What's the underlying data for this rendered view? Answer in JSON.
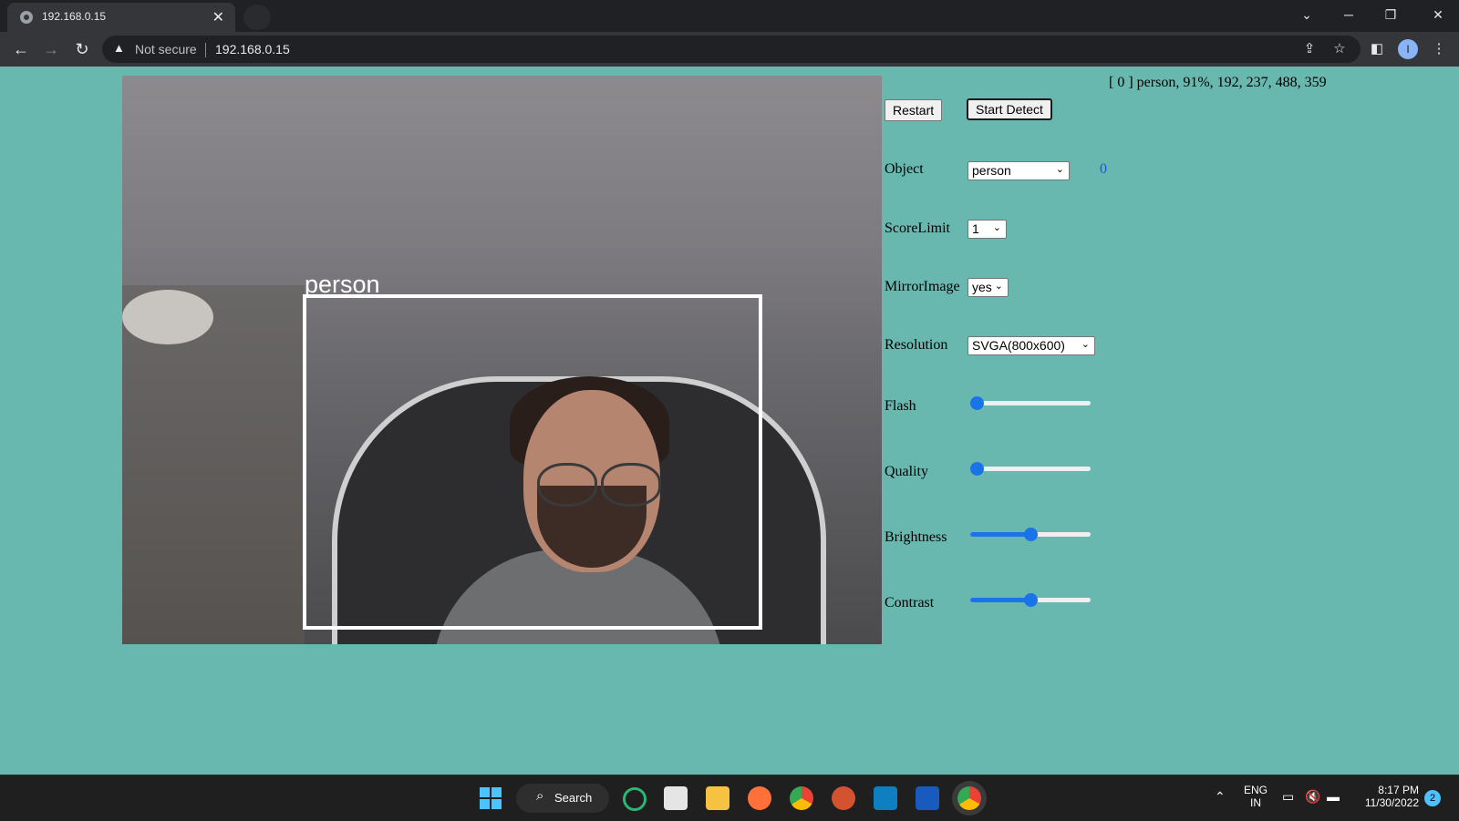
{
  "browser": {
    "tab_title": "192.168.0.15",
    "security_text": "Not secure",
    "url": "192.168.0.15",
    "profile_initial": "I"
  },
  "camera": {
    "bbox_label": "person"
  },
  "detection": {
    "result_text": "[ 0 ] person, 91%, 192, 237, 488, 359",
    "restart_label": "Restart",
    "start_detect_label": "Start Detect"
  },
  "controls": {
    "object": {
      "label": "Object",
      "value": "person",
      "count": "0"
    },
    "score_limit": {
      "label": "ScoreLimit",
      "value": "1"
    },
    "mirror_image": {
      "label": "MirrorImage",
      "value": "yes"
    },
    "resolution": {
      "label": "Resolution",
      "value": "SVGA(800x600)"
    },
    "flash": {
      "label": "Flash",
      "fraction": 0.0
    },
    "quality": {
      "label": "Quality",
      "fraction": 0.0
    },
    "brightness": {
      "label": "Brightness",
      "fraction": 0.5
    },
    "contrast": {
      "label": "Contrast",
      "fraction": 0.5
    }
  },
  "taskbar": {
    "search_label": "Search",
    "lang_top": "ENG",
    "lang_bottom": "IN",
    "time": "8:17 PM",
    "date": "11/30/2022",
    "notification_count": "2"
  }
}
